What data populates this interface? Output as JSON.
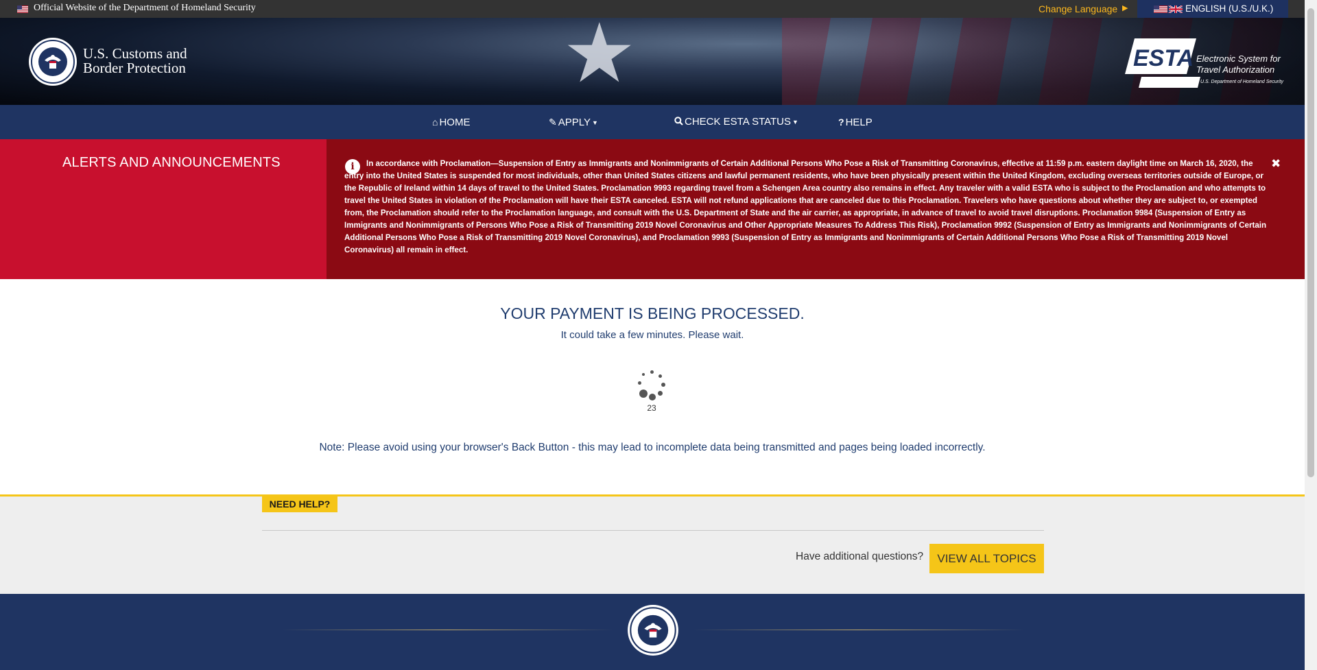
{
  "top_bar": {
    "official_text": "Official Website of the Department of Homeland Security",
    "change_language": "Change Language",
    "language": "ENGLISH (U.S./U.K.)"
  },
  "header": {
    "agency_line1": "U.S. Customs and",
    "agency_line2": "Border Protection",
    "esta_wordmark": "ESTA",
    "esta_line1": "Electronic System for",
    "esta_line2": "Travel Authorization",
    "esta_dept": "U.S. Department of Homeland Security"
  },
  "nav": {
    "home": "HOME",
    "apply": "APPLY",
    "check_status": "CHECK ESTA STATUS",
    "help": "HELP"
  },
  "alerts": {
    "title": "ALERTS AND ANNOUNCEMENTS",
    "message": "In accordance with Proclamation—Suspension of Entry as Immigrants and Nonimmigrants of Certain Additional Persons Who Pose a Risk of Transmitting Coronavirus, effective at 11:59 p.m. eastern daylight time on March 16, 2020, the entry into the United States is suspended for most individuals, other than United States citizens and lawful permanent residents, who have been physically present within the United Kingdom, excluding overseas territories outside of Europe, or the Republic of Ireland within 14 days of travel to the United States. Proclamation 9993 regarding travel from a Schengen Area country also remains in effect. Any traveler with a valid ESTA who is subject to the Proclamation and who attempts to travel the United States in violation of the Proclamation will have their ESTA canceled. ESTA will not refund applications that are canceled due to this Proclamation. Travelers who have questions about whether they are subject to, or exempted from, the Proclamation should refer to the Proclamation language, and consult with the U.S. Department of State and the air carrier, as appropriate, in advance of travel to avoid travel disruptions. Proclamation 9984 (Suspension of Entry as Immigrants and Nonimmigrants of Persons Who Pose a Risk of Transmitting 2019 Novel Coronavirus and Other Appropriate Measures To Address This Risk), Proclamation 9992 (Suspension of Entry as Immigrants and Nonimmigrants of Certain Additional Persons Who Pose a Risk of Transmitting 2019 Novel Coronavirus), and Proclamation 9993 (Suspension of Entry as Immigrants and Nonimmigrants of Certain Additional Persons Who Pose a Risk of Transmitting 2019 Novel Coronavirus) all remain in effect.",
    "close_glyph": "✖"
  },
  "main": {
    "title": "YOUR PAYMENT IS BEING PROCESSED.",
    "subtitle": "It could take a few minutes. Please wait.",
    "counter": "23",
    "note": "Note: Please avoid using your browser's Back Button - this may lead to incomplete data being transmitted and pages being loaded incorrectly."
  },
  "help": {
    "badge": "NEED HELP?",
    "question": "Have additional questions?",
    "button": "VIEW ALL TOPICS"
  },
  "icons": {
    "home": "home-icon",
    "apply": "pencil-icon",
    "check": "search-icon",
    "help": "question-icon",
    "info": "info-icon",
    "close": "close-icon"
  },
  "colors": {
    "nav_blue": "#1f3462",
    "alert_red": "#c8102e",
    "alert_dark_red": "#8b0a13",
    "title_blue": "#1f3c6e",
    "help_yellow": "#f5c518",
    "lang_orange": "#fdb81e"
  }
}
